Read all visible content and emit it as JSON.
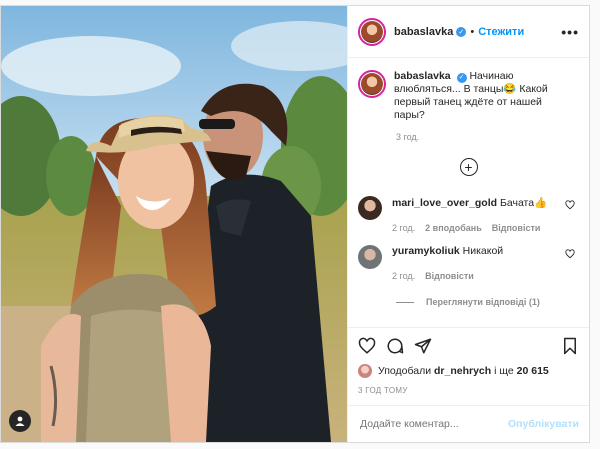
{
  "header": {
    "username": "babaslavka",
    "separator": "•",
    "follow_label": "Стежити",
    "more_icon": "•••"
  },
  "caption": {
    "username": "babaslavka",
    "text": "Начинаю влюбляться... В танцы😂 Какой первый танец ждёте от нашей пары?",
    "time": "3 год."
  },
  "load_more_icon": "+",
  "comments": [
    {
      "username": "mari_love_over_gold",
      "text": "Бачата👍",
      "time": "2 год.",
      "likes": "2 вподобань",
      "reply_label": "Відповісти"
    },
    {
      "username": "yuramykoliuk",
      "text": "Никакой",
      "time": "2 год.",
      "reply_label": "Відповісти"
    }
  ],
  "view_replies": "Переглянути відповіді (1)",
  "likes": {
    "prefix": "Уподобали",
    "user": "dr_nehrych",
    "middle": "і ще",
    "count": "20 615"
  },
  "time_ago": "3 ГОД ТОМУ",
  "add_comment": {
    "placeholder": "Додайте коментар...",
    "publish_label": "Опублікувати"
  },
  "colors": {
    "accent": "#0095f6",
    "verified": "#3897f0",
    "publish_disabled": "#b2dffc"
  }
}
